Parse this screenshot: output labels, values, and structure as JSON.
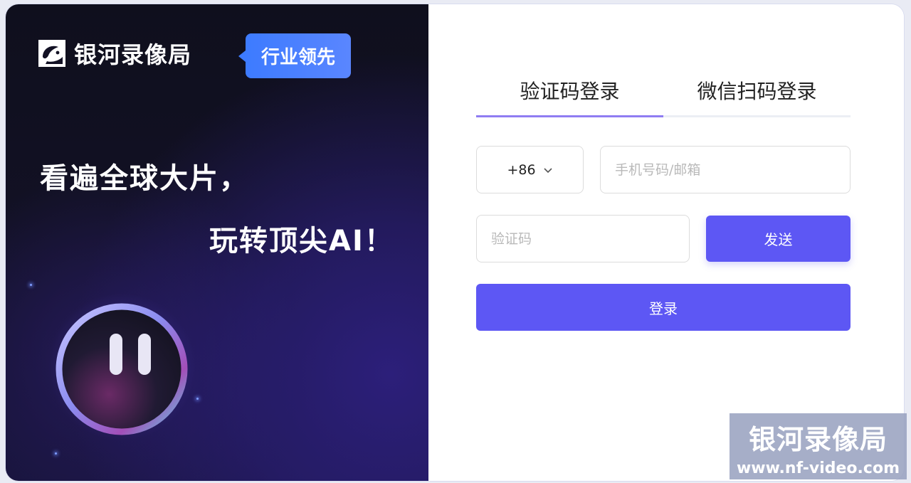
{
  "brand": {
    "name": "银河录像局",
    "badge": "行业领先"
  },
  "hero": {
    "line1": "看遍全球大片，",
    "line2": "玩转顶尖AI！"
  },
  "login": {
    "tabs": [
      {
        "label": "验证码登录",
        "active": true
      },
      {
        "label": "微信扫码登录",
        "active": false
      }
    ],
    "country_code": "+86",
    "phone_placeholder": "手机号码/邮箱",
    "code_placeholder": "验证码",
    "send_label": "发送",
    "submit_label": "登录"
  },
  "watermark": {
    "title": "银河录像局",
    "url": "www.nf-video.com"
  },
  "colors": {
    "accent": "#5d57f4",
    "badge": "#3d7bff",
    "tab_underline": "#8f7df2"
  }
}
